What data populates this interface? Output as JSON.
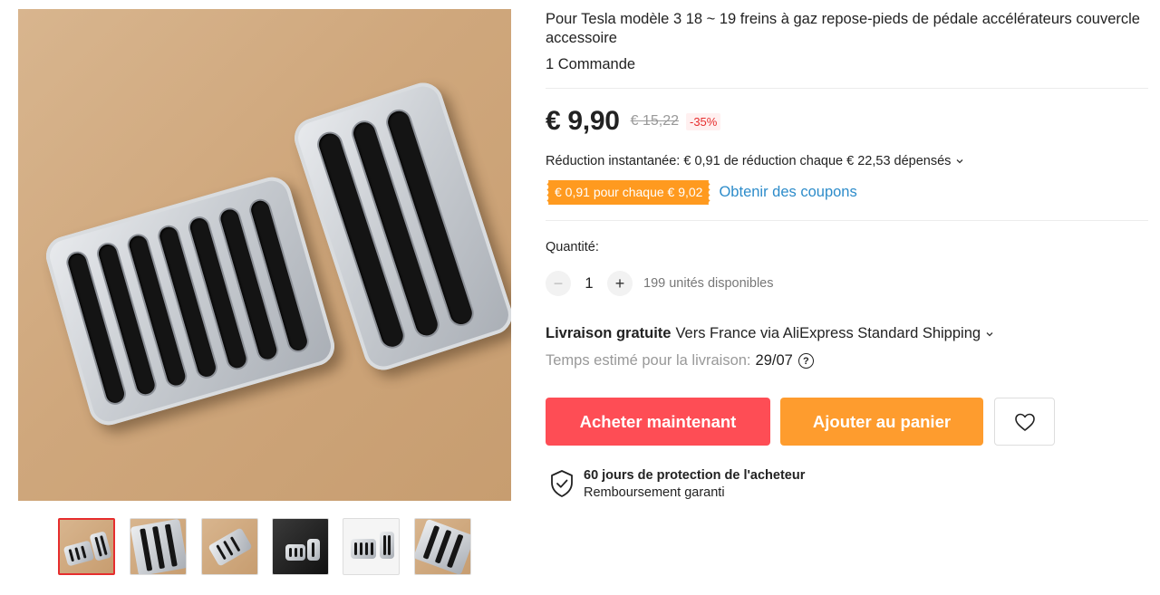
{
  "product": {
    "title": "Pour Tesla modèle 3 18 ~ 19 freins à gaz repose-pieds de pédale accélérateurs couvercle accessoire",
    "orders": "1 Commande"
  },
  "price": {
    "current": "€ 9,90",
    "original": "€ 15,22",
    "discount": "-35%"
  },
  "promo": {
    "instant_discount": "Réduction instantanée: € 0,91 de réduction chaque € 22,53 dépensés",
    "coupon_tag": "€ 0,91 pour chaque € 9,02",
    "coupon_link": "Obtenir des coupons"
  },
  "quantity": {
    "label": "Quantité:",
    "minus": "−",
    "value": "1",
    "plus": "+",
    "available": "199 unités disponibles"
  },
  "shipping": {
    "free_label": "Livraison gratuite",
    "route": "Vers France via AliExpress Standard Shipping",
    "estimate_label": "Temps estimé pour la livraison:",
    "estimate_date": "29/07",
    "help_glyph": "?"
  },
  "actions": {
    "buy_now": "Acheter maintenant",
    "add_to_cart": "Ajouter au panier"
  },
  "protection": {
    "title": "60 jours de protection de l'acheteur",
    "subtitle": "Remboursement garanti"
  },
  "colors": {
    "buy_button": "#fe4d55",
    "cart_button": "#fe9c2e",
    "coupon_tag": "#ff9a1f",
    "link": "#2d8cca",
    "discount": "#e62e2e"
  },
  "icons": [
    "heart-icon",
    "shield-check-icon",
    "help-circle-icon",
    "chevron-down-icon"
  ]
}
